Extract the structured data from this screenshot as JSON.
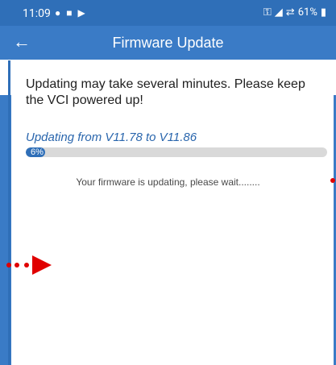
{
  "status_bar": {
    "time": "11:09",
    "left_icons": "● ■ ▶",
    "battery": "61%"
  },
  "app_bar": {
    "title": "Firmware Update",
    "back_icon": "←"
  },
  "content": {
    "message": "Updating may take several minutes. Please keep the VCI powered up!",
    "progress_label": "Updating from V11.78 to V11.86",
    "progress_text": "6%",
    "progress_fraction": 0.06,
    "wait_text": "Your firmware is updating, please wait........"
  },
  "colors": {
    "status_bar": "#2f6fb8",
    "app_bar": "#3a7bc6",
    "accent": "#2a66ad",
    "annotation": "#e00000"
  }
}
